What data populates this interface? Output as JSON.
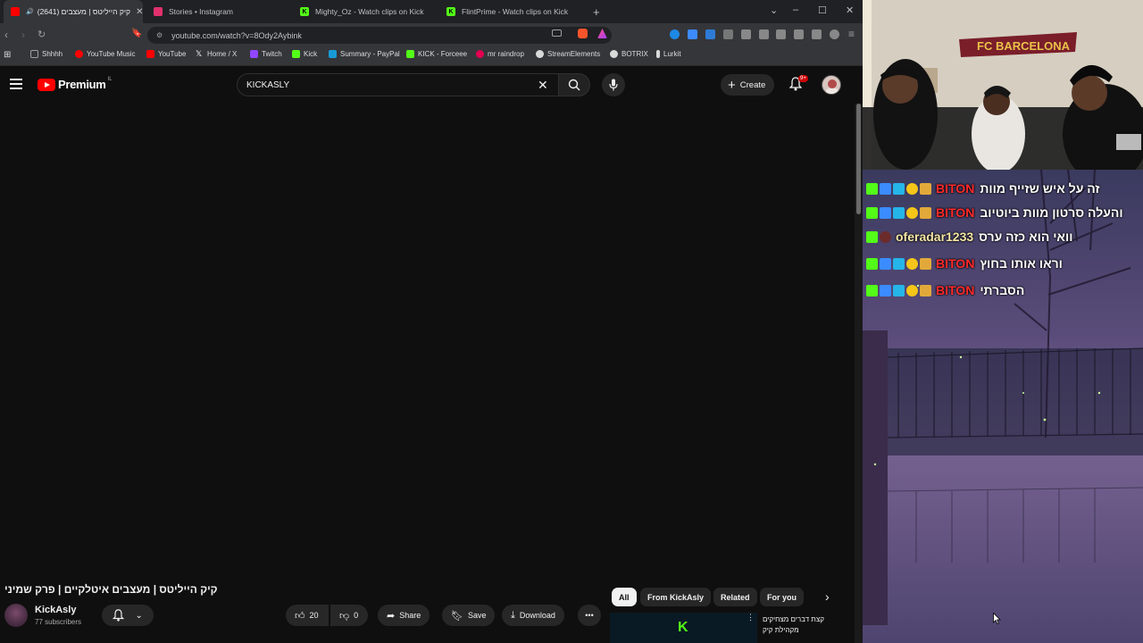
{
  "browser": {
    "tabs": [
      {
        "label": "קיק הייליטס | מעצבים (2641)",
        "favicon_color": "#ff0000",
        "active": true
      },
      {
        "label": "Stories • Instagram",
        "favicon_color": "#e1306c",
        "active": false
      },
      {
        "label": "Mighty_Oz - Watch clips on Kick",
        "favicon_color": "#53fc18",
        "active": false
      },
      {
        "label": "FlintPrime - Watch clips on Kick",
        "favicon_color": "#53fc18",
        "active": false
      }
    ],
    "new_tab": "+",
    "url": "youtube.com/watch?v=8Ody2Aybink",
    "bookmarks": [
      {
        "label": "Shhhh",
        "color": "#9aa0a6"
      },
      {
        "label": "YouTube Music",
        "color": "#ff0000"
      },
      {
        "label": "YouTube",
        "color": "#ff0000"
      },
      {
        "label": "Home / X",
        "color": "#ffffff"
      },
      {
        "label": "Twitch",
        "color": "#9146ff"
      },
      {
        "label": "Kick",
        "color": "#53fc18"
      },
      {
        "label": "Summary - PayPal",
        "color": "#179bd7"
      },
      {
        "label": "KICK - Forceee",
        "color": "#53fc18"
      },
      {
        "label": "mr raindrop",
        "color": "#e3004f"
      },
      {
        "label": "StreamElements",
        "color": "#d9d9d9"
      },
      {
        "label": "BOTRIX",
        "color": "#d9d9d9"
      },
      {
        "label": "Lurkit",
        "color": "#d9d9d9"
      }
    ]
  },
  "youtube": {
    "logo": "Premium",
    "logo_country": "IL",
    "search": {
      "value": "KICKASLY"
    },
    "create_label": "Create",
    "notification_badge": "9+",
    "video_title": "קיק הייליטס | מעצבים איטלקיים | פרק שמיני",
    "channel": {
      "name": "KickAsly",
      "subscribers": "77 subscribers"
    },
    "actions": {
      "likes": "20",
      "dislikes": "0",
      "share": "Share",
      "save": "Save",
      "download": "Download"
    },
    "chips": [
      "All",
      "From KickAsly",
      "Related",
      "For you"
    ],
    "recommendation": {
      "title": "קצת דברים מצחיקים מקהילת קיק"
    }
  },
  "stream_chat": [
    {
      "user": "BITON",
      "text": "זה על איש שזייף מוות",
      "user_color": "#ff2a2a"
    },
    {
      "user": "BITON",
      "text": "והעלה סרטון מוות ביוטיוב",
      "user_color": "#ff2a2a"
    },
    {
      "user": "oferadar1233",
      "text": "וואי הוא כזה ערס",
      "user_color": "#ffffff"
    },
    {
      "user": "BITON",
      "text": "וראו אותו בחוץ",
      "user_color": "#ff2a2a"
    },
    {
      "user": "BITON",
      "text": "הסברתי",
      "user_color": "#ff2a2a"
    }
  ],
  "stream_banner": "FC BARCELONA",
  "colors": {
    "kick_green": "#53fc18",
    "yt_red": "#ff0000",
    "bg": "#0f0f0f"
  }
}
